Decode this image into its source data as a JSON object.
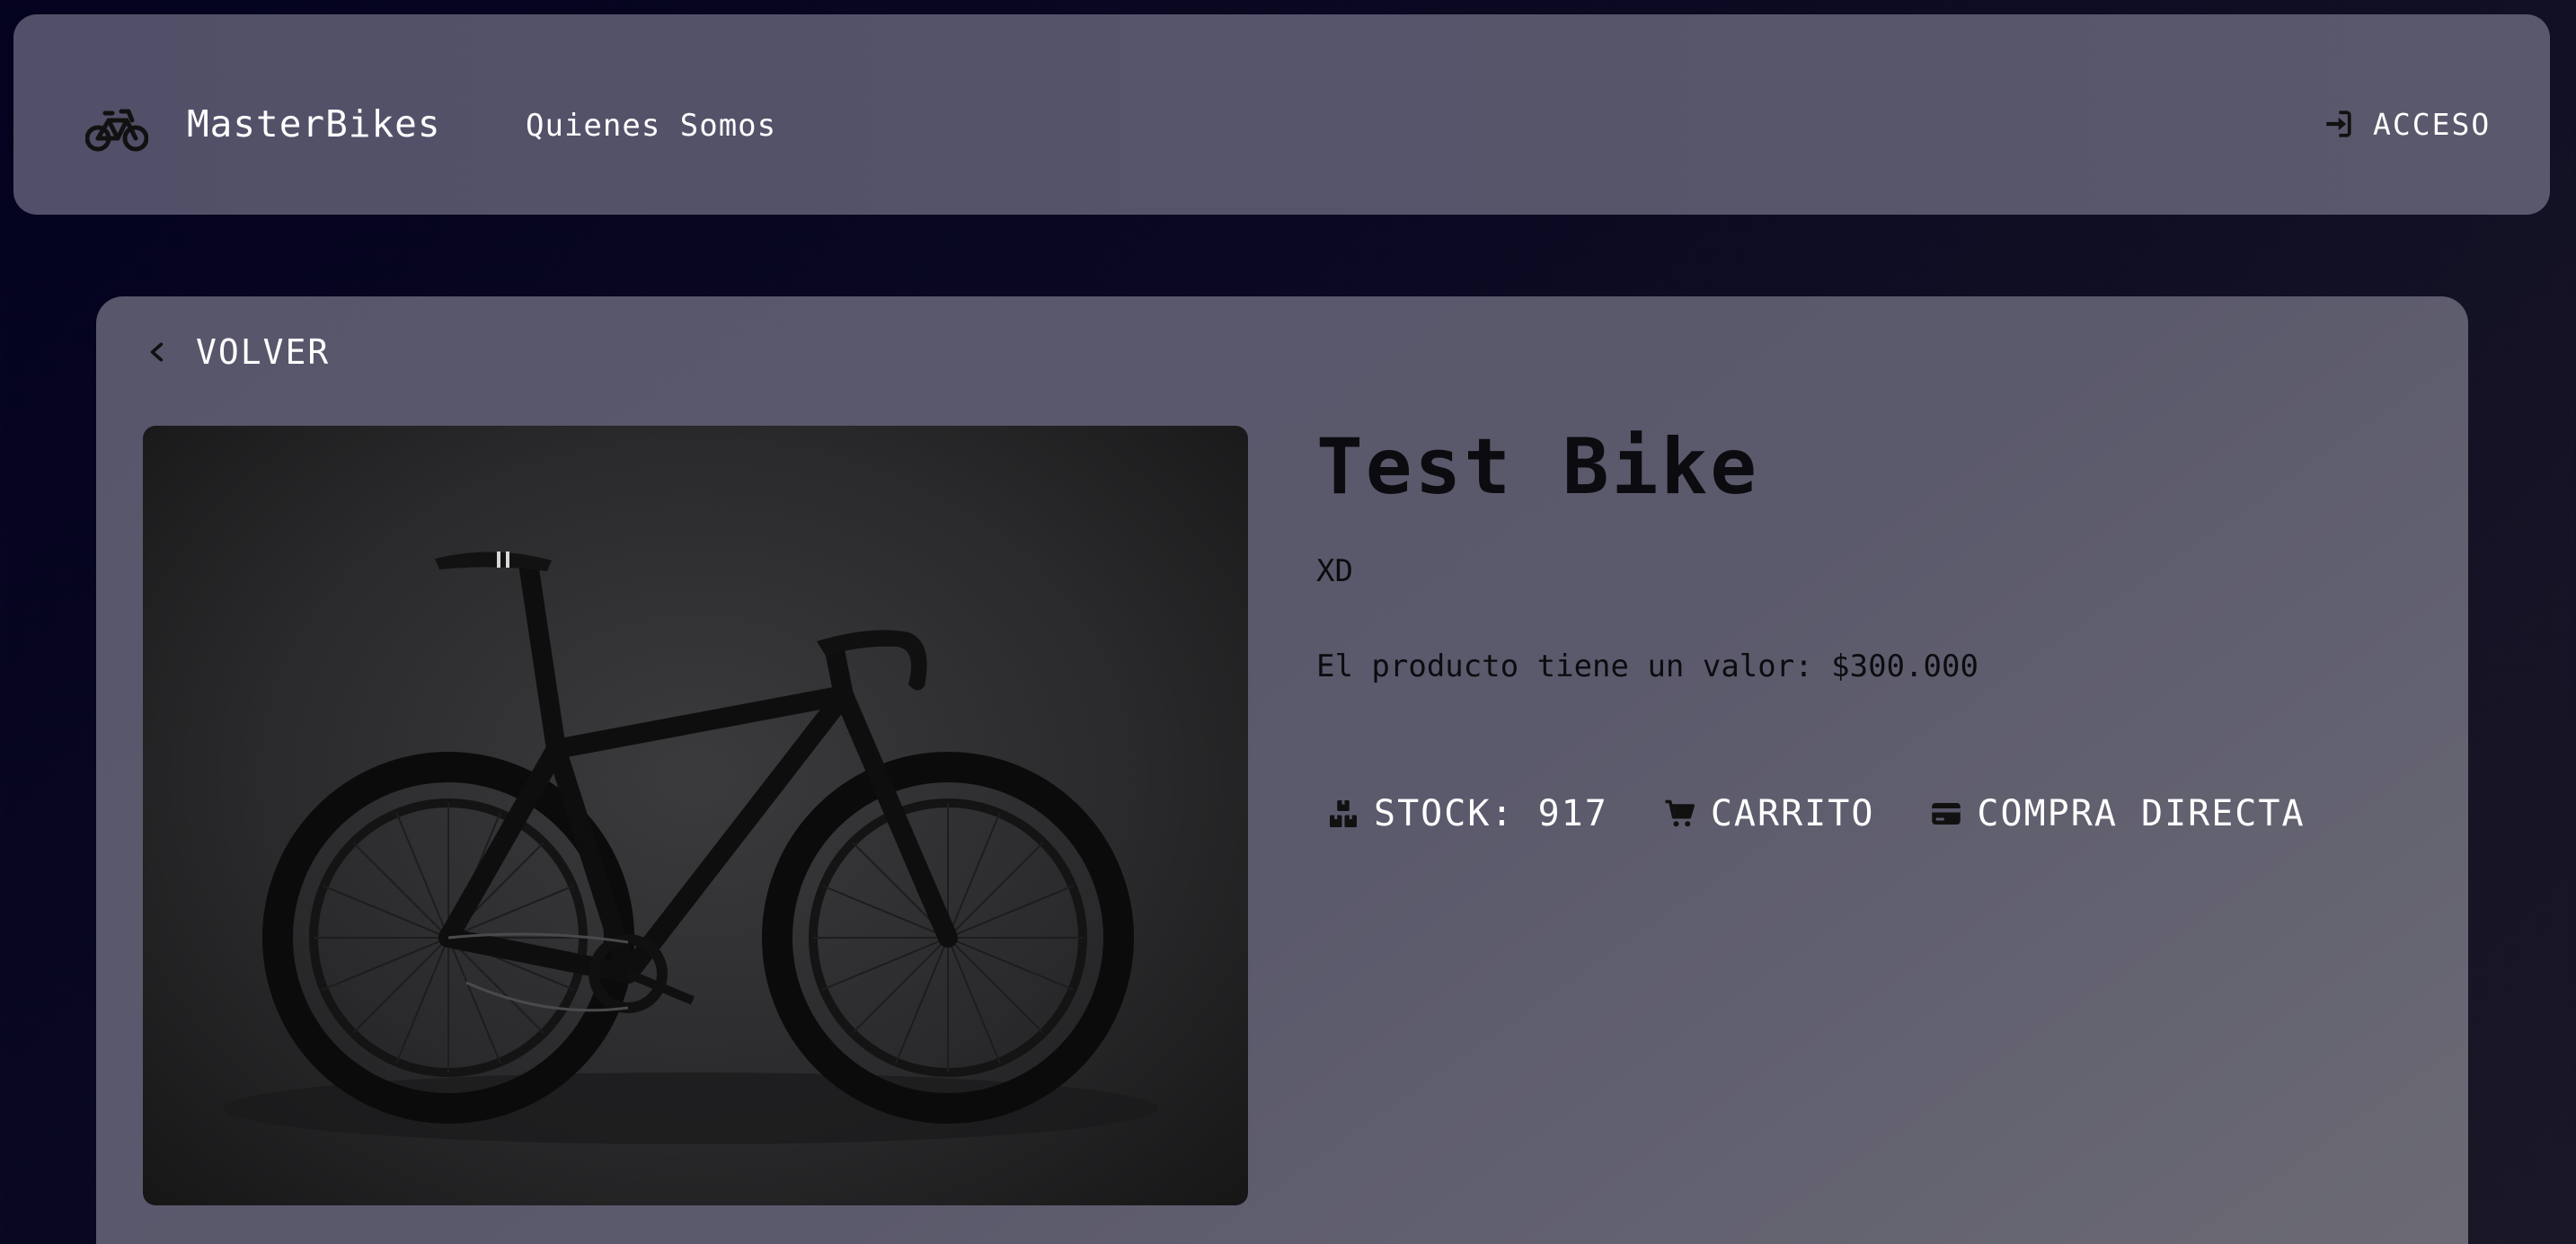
{
  "navbar": {
    "brand": "MasterBikes",
    "logo_icon": "bicycle-icon",
    "links": [
      {
        "label": "Quienes Somos"
      }
    ],
    "login": {
      "label": "ACCESO",
      "icon": "sign-in-icon"
    }
  },
  "product": {
    "back_label": "VOLVER",
    "back_icon": "chevron-left-icon",
    "image_alt": "bicycle photo",
    "title": "Test Bike",
    "subtitle": "XD",
    "price_text": "El producto tiene un valor: $300.000",
    "stock": {
      "label": "STOCK: 917",
      "icon": "boxes-icon"
    },
    "cart": {
      "label": "CARRITO",
      "icon": "cart-icon"
    },
    "buy": {
      "label": "COMPRA DIRECTA",
      "icon": "credit-card-icon"
    }
  },
  "colors": {
    "background": "#03021f",
    "panel": "#58566b",
    "text_dark": "#0c0c10",
    "text_light": "#ffffff"
  }
}
